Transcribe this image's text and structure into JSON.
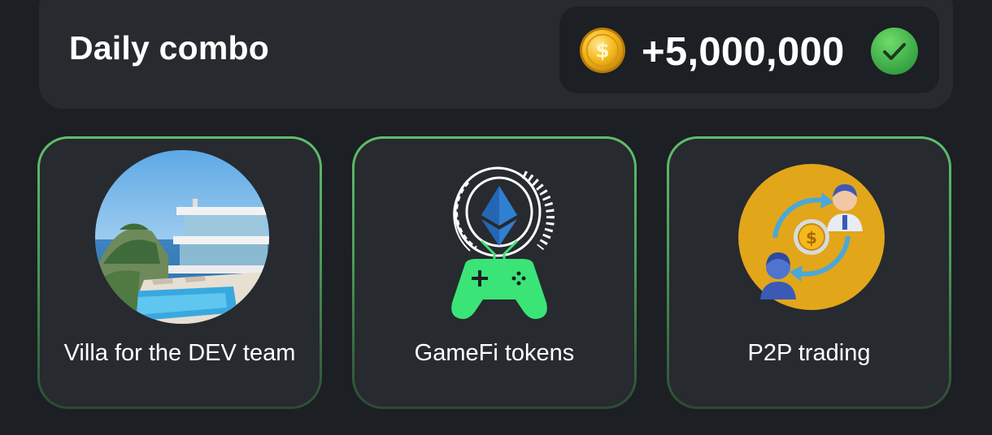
{
  "header": {
    "title": "Daily combo",
    "reward_amount": "+5,000,000",
    "coin_icon": "gold-dollar-coin-icon",
    "status_icon": "green-check-icon"
  },
  "cards": [
    {
      "label": "Villa for the DEV team",
      "icon": "villa-image",
      "highlight": "#5fbf6a"
    },
    {
      "label": "GameFi tokens",
      "icon": "gamepad-ethereum-icon",
      "highlight": "#5fbf6a"
    },
    {
      "label": "P2P trading",
      "icon": "p2p-trading-icon",
      "highlight": "#5fbf6a"
    }
  ],
  "colors": {
    "background": "#1c1f24",
    "panel": "#272a2f",
    "accent_green": "#3be477",
    "coin_gold": "#f5b91e",
    "trading_circle": "#e2a61a"
  }
}
